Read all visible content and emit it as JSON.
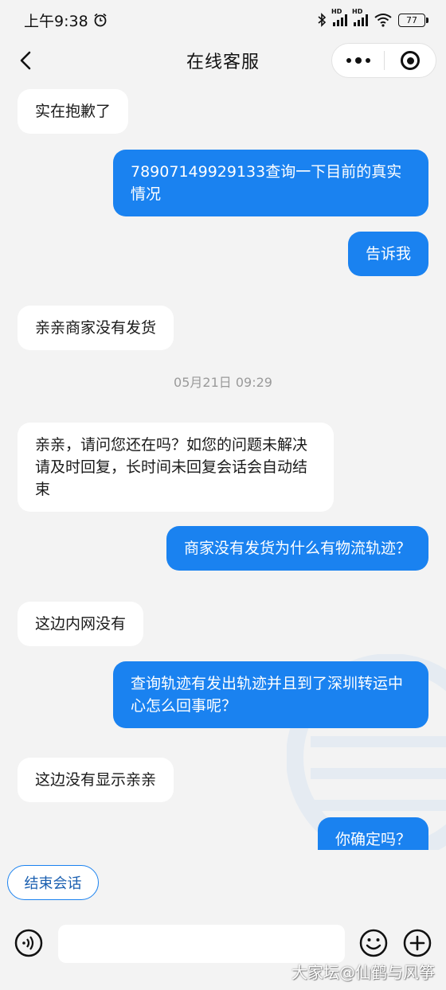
{
  "status_bar": {
    "time": "上午9:38",
    "battery": "77"
  },
  "nav": {
    "title": "在线客服"
  },
  "messages": [
    {
      "text": "实在抱歉了"
    },
    {
      "text": "78907149929133查询一下目前的真实情况"
    },
    {
      "text": "告诉我"
    },
    {
      "text": "亲亲商家没有发货"
    },
    {
      "text": "05月21日 09:29"
    },
    {
      "text": "亲亲，请问您还在吗？如您的问题未解决请及时回复，长时间未回复会话会自动结束"
    },
    {
      "text": "商家没有发货为什么有物流轨迹？"
    },
    {
      "text": "这边内网没有"
    },
    {
      "text": "查询轨迹有发出轨迹并且到了深圳转运中心怎么回事呢？"
    },
    {
      "text": "这边没有显示亲亲"
    },
    {
      "text": "你确定吗？"
    }
  ],
  "end_session": {
    "label": "结束会话"
  },
  "input": {
    "placeholder": ""
  },
  "watermark": "大家坛@仙鹤与风筝",
  "colors": {
    "accent": "#1a82f0",
    "background": "#f3f3f3",
    "incoming_bubble": "#ffffff"
  }
}
